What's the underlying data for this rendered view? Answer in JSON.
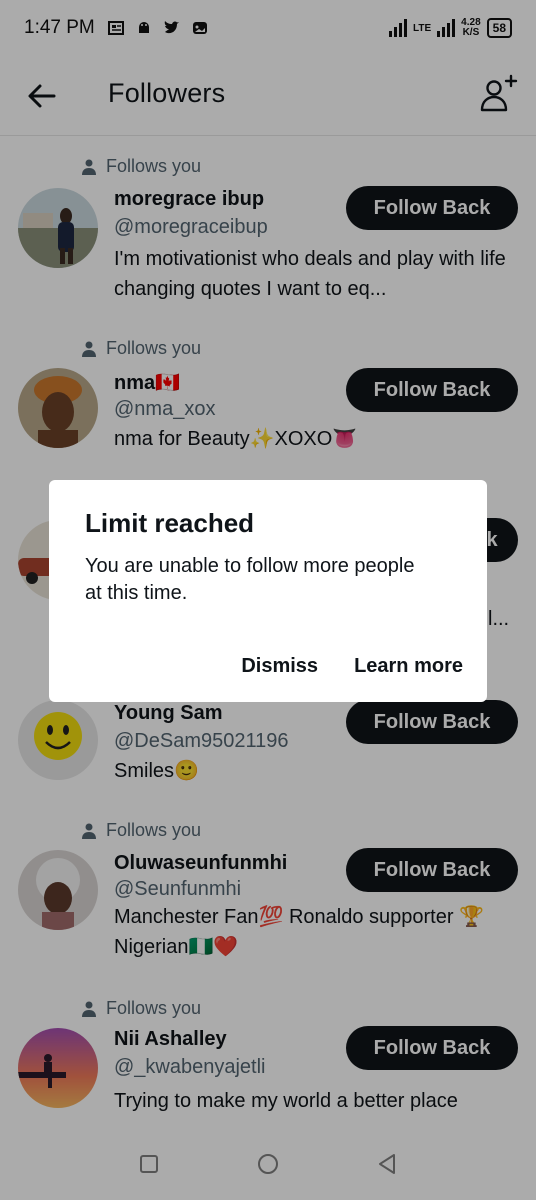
{
  "status_bar": {
    "time": "1:47 PM",
    "network": "LTE",
    "speed": "4.28",
    "speed_unit": "K/S",
    "battery": "58"
  },
  "header": {
    "title": "Followers"
  },
  "followers": [
    {
      "follows_you": "Follows you",
      "name": "moregrace ibup",
      "handle": "@moregraceibup",
      "bio": "I'm motivationist who deals and play with life changing quotes  I want to eq...",
      "button": "Follow Back"
    },
    {
      "follows_you": "Follows you",
      "name": "nma🇨🇦",
      "handle": "@nma_xox",
      "bio": "nma  for Beauty✨XOXO👅",
      "button": "Follow Back"
    },
    {
      "partial_button": "k",
      "partial_bio": "l..."
    },
    {
      "name": "Young Sam",
      "handle": "@DeSam95021196",
      "bio": "Smiles🙂",
      "button": "Follow Back"
    },
    {
      "follows_you": "Follows you",
      "name": "Oluwaseunfunmhi",
      "handle": "@Seunfunmhi",
      "bio": "Manchester Fan💯 Ronaldo supporter 🏆 Nigerian🇳🇬❤️",
      "button": "Follow Back"
    },
    {
      "follows_you": "Follows you",
      "name": "Nii Ashalley",
      "handle": "@_kwabenyajetli",
      "bio": "Trying to make my world a better place",
      "button": "Follow Back"
    }
  ],
  "dialog": {
    "title": "Limit reached",
    "message": "You are unable to follow more people at this time.",
    "dismiss": "Dismiss",
    "learn_more": "Learn more"
  },
  "icons": {
    "back": "arrow-left-icon",
    "add_user": "add-user-icon",
    "person": "person-icon",
    "nav_recent": "square-icon",
    "nav_home": "circle-icon",
    "nav_back": "triangle-back-icon"
  },
  "colors": {
    "button_bg": "#0f1419",
    "secondary_text": "#536471",
    "overlay": "rgba(0,0,0,0.33)"
  }
}
